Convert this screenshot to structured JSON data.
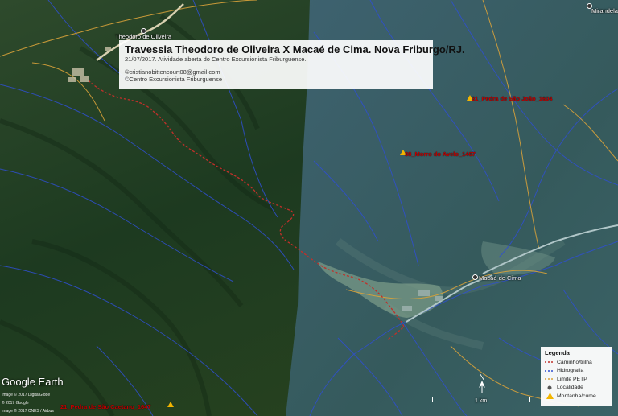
{
  "info": {
    "title": "Travessia Theodoro de Oliveira X Macaé de Cima. Nova Friburgo/RJ.",
    "description": "21/07/2017. Atividade aberta do Centro Excursionista Friburguense.",
    "contact": "©cristianobittencourt08@gmail.com",
    "organization": "©Centro Excursionista Friburguense"
  },
  "places": [
    {
      "name": "Theodoro de Oliveira"
    },
    {
      "name": "Macaé de Cima"
    },
    {
      "name": "Mirandela"
    }
  ],
  "peaks": [
    {
      "name": "31_Pedra de São João_1604"
    },
    {
      "name": "38_Morro do Avelo_1467"
    },
    {
      "name": "21_Pedra de São Caetano_1647"
    }
  ],
  "legend": {
    "title": "Legenda",
    "items": [
      {
        "label": "Caminho/trilha",
        "color": "#c0302a",
        "icon": "red-dashed-line-icon"
      },
      {
        "label": "Hidrografia",
        "color": "#2f4fd0",
        "icon": "blue-dashed-line-icon"
      },
      {
        "label": "Limite PETP",
        "color": "#d9a23a",
        "icon": "orange-dashed-line-icon"
      },
      {
        "label": "Localidade",
        "color": "#555555",
        "icon": "locality-dot-icon"
      },
      {
        "label": "Montanha/cume",
        "color": "#f2b500",
        "icon": "mountain-triangle-icon"
      }
    ]
  },
  "branding": {
    "logo": "Google Earth",
    "credits": [
      "Image © 2017 DigitalGlobe",
      "© 2017 Google",
      "Image © 2017 CNES / Airbus"
    ]
  },
  "scale": {
    "label": "1 km"
  },
  "north": {
    "label": "N"
  },
  "colors": {
    "forest_dark": "#1f3d22",
    "forest_light": "#2f5a55",
    "haze": "#7fa0c8",
    "trail": "#c0302a",
    "river": "#2f4fd0",
    "park_boundary": "#d9a23a"
  }
}
